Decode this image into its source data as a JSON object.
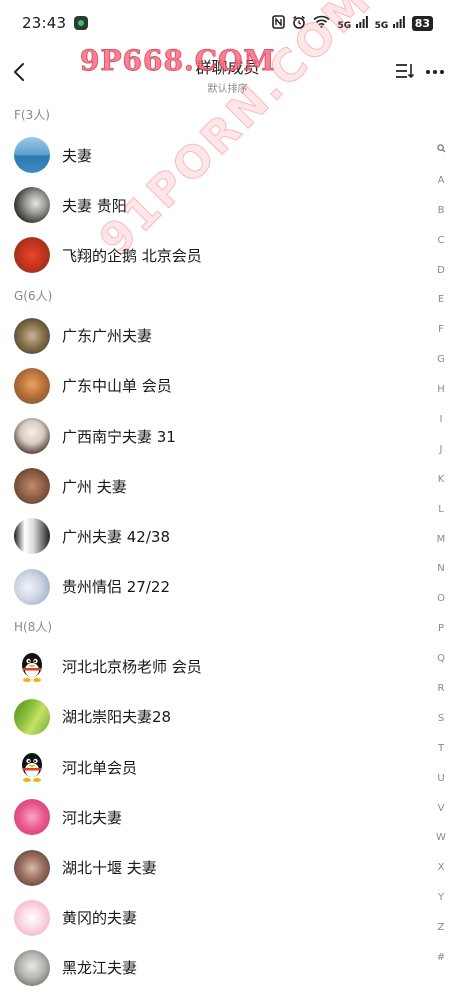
{
  "status": {
    "time": "23:43",
    "signal1": "5G",
    "signal2": "5G",
    "battery": "83"
  },
  "header": {
    "title": "群聊成员",
    "subtitle": "默认排序",
    "watermark": "9P668.COM",
    "watermark_diag": "91PORN.COM"
  },
  "sections": [
    {
      "label": "F(3人)",
      "members": [
        {
          "name": "夫妻"
        },
        {
          "name": "夫妻  贵阳"
        },
        {
          "name": "飞翔的企鹅  北京会员"
        }
      ]
    },
    {
      "label": "G(6人)",
      "members": [
        {
          "name": "广东广州夫妻"
        },
        {
          "name": "广东中山单  会员"
        },
        {
          "name": "广西南宁夫妻 31"
        },
        {
          "name": "广州 夫妻"
        },
        {
          "name": "广州夫妻  42/38"
        },
        {
          "name": "贵州情侣 27/22"
        }
      ]
    },
    {
      "label": "H(8人)",
      "members": [
        {
          "name": "河北北京杨老师 会员"
        },
        {
          "name": "湖北崇阳夫妻28"
        },
        {
          "name": "河北单会员"
        },
        {
          "name": "河北夫妻"
        },
        {
          "name": "湖北十堰 夫妻"
        },
        {
          "name": "黄冈的夫妻"
        },
        {
          "name": "黑龙江夫妻"
        }
      ]
    }
  ],
  "index": [
    "A",
    "B",
    "C",
    "D",
    "E",
    "F",
    "G",
    "H",
    "I",
    "J",
    "K",
    "L",
    "M",
    "N",
    "O",
    "P",
    "Q",
    "R",
    "S",
    "T",
    "U",
    "V",
    "W",
    "X",
    "Y",
    "Z",
    "#"
  ],
  "colors": {
    "accent_watermark": "#ff6b7d",
    "section_text": "#8a8a8a"
  }
}
